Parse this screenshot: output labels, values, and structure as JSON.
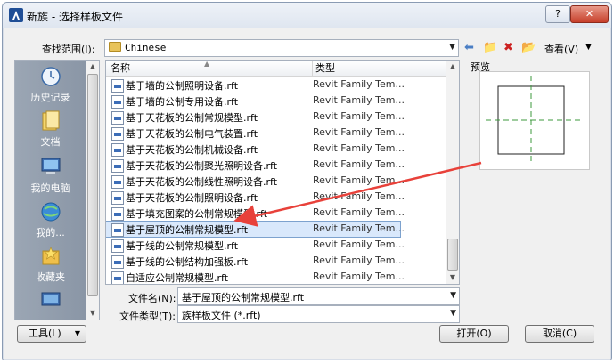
{
  "window": {
    "title": "新族 - 选择样板文件",
    "help_label": "?",
    "close_label": "✕"
  },
  "lookin": {
    "label": "查找范围(I):",
    "value": "Chinese",
    "view_label": "查看(V)"
  },
  "places": [
    {
      "label": "历史记录",
      "icon": "history-icon"
    },
    {
      "label": "文档",
      "icon": "documents-icon"
    },
    {
      "label": "我的电脑",
      "icon": "computer-icon"
    },
    {
      "label": "我的...",
      "icon": "network-icon"
    },
    {
      "label": "收藏夹",
      "icon": "favorites-icon"
    }
  ],
  "filelist": {
    "col_name": "名称",
    "col_type": "类型",
    "rows": [
      {
        "name": "基于墙的公制照明设备.rft",
        "type": "Revit Family Tem..."
      },
      {
        "name": "基于墙的公制专用设备.rft",
        "type": "Revit Family Tem..."
      },
      {
        "name": "基于天花板的公制常规模型.rft",
        "type": "Revit Family Tem..."
      },
      {
        "name": "基于天花板的公制电气装置.rft",
        "type": "Revit Family Tem..."
      },
      {
        "name": "基于天花板的公制机械设备.rft",
        "type": "Revit Family Tem..."
      },
      {
        "name": "基于天花板的公制聚光照明设备.rft",
        "type": "Revit Family Tem..."
      },
      {
        "name": "基于天花板的公制线性照明设备.rft",
        "type": "Revit Family Tem..."
      },
      {
        "name": "基于天花板的公制照明设备.rft",
        "type": "Revit Family Tem..."
      },
      {
        "name": "基于填充图案的公制常规模型.rft",
        "type": "Revit Family Tem..."
      },
      {
        "name": "基于屋顶的公制常规模型.rft",
        "type": "Revit Family Tem..."
      },
      {
        "name": "基于线的公制常规模型.rft",
        "type": "Revit Family Tem..."
      },
      {
        "name": "基于线的公制结构加强板.rft",
        "type": "Revit Family Tem..."
      },
      {
        "name": "自适应公制常规模型.rft",
        "type": "Revit Family Tem..."
      }
    ],
    "selected_index": 9
  },
  "preview": {
    "label": "预览"
  },
  "filename": {
    "label": "文件名(N):",
    "value": "基于屋顶的公制常规模型.rft"
  },
  "filetype": {
    "label": "文件类型(T):",
    "value": "族样板文件 (*.rft)"
  },
  "buttons": {
    "tools": "工具(L)",
    "open": "打开(O)",
    "cancel": "取消(C)"
  },
  "colors": {
    "selection": "#d9e8fb",
    "annotation_arrow": "#e8413a",
    "preview_dash": "#3c9a3c"
  }
}
